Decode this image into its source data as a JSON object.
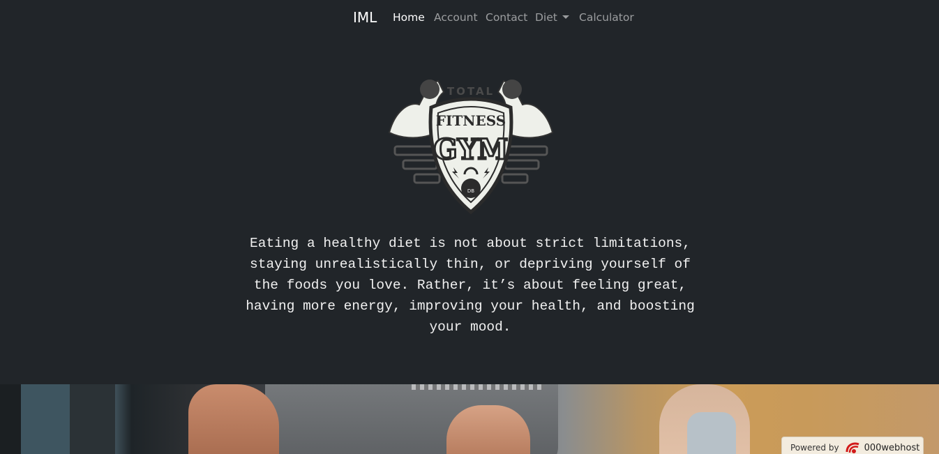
{
  "nav": {
    "brand": "IML",
    "items": [
      {
        "label": "Home",
        "active": true
      },
      {
        "label": "Account"
      },
      {
        "label": "Contact"
      },
      {
        "label": "Diet",
        "dropdown": true
      },
      {
        "label": "Calculator"
      }
    ]
  },
  "logo": {
    "arc_text": "TOTAL",
    "line1": "FITNESS",
    "line2": "GYM",
    "kettlebell": "DB"
  },
  "intro": {
    "text": "Eating a healthy diet is not about strict limitations, staying unrealistically thin, or depriving yourself of the foods you love. Rather, it’s about feeling great, having more energy, improving your health, and boosting your mood."
  },
  "badge": {
    "powered_by": "Powered by",
    "host": "000webhost"
  },
  "colors": {
    "background": "#212529",
    "nav_active": "#ffffff",
    "nav_inactive": "rgba(255,255,255,0.55)"
  }
}
